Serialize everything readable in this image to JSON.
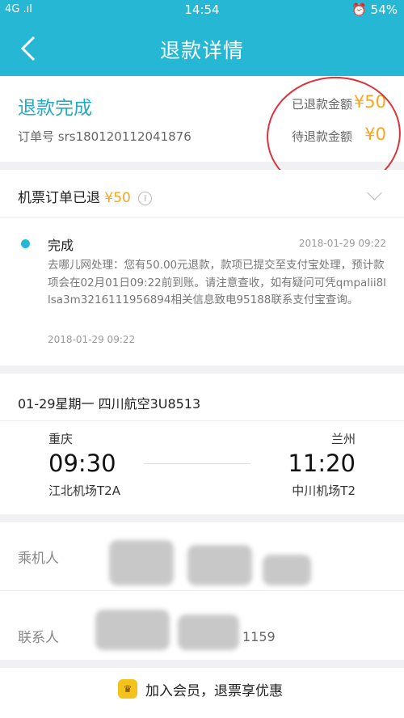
{
  "status_bar": {
    "left": "4G .ıl",
    "time": "14:54",
    "battery": "54%"
  },
  "nav": {
    "title": "退款详情"
  },
  "summary": {
    "status": "退款完成",
    "order_label": "订单号",
    "order_no": "srs180120112041876",
    "refunded_label": "已退款金额",
    "refunded_amount": "¥50",
    "pending_label": "待退款金额",
    "pending_amount": "¥0"
  },
  "refund": {
    "title": "机票订单已退",
    "amount": "¥50",
    "info_icon": "i",
    "progress_title": "完成",
    "progress_time": "2018-01-29 09:22",
    "progress_desc": "去哪儿网处理：您有50.00元退款，款项已提交至支付宝处理，预计款项会在02月01日09:22前到账。请注意查收，如有疑问可凭qmpalii8llsa3m3216111956894相关信息致电95188联系支付宝查询。",
    "progress_time2": "2018-01-29 09:22"
  },
  "flight": {
    "date_line": "01-29星期一  四川航空3U8513",
    "from_city": "重庆",
    "from_time": "09:30",
    "from_airport": "江北机场T2A",
    "to_city": "兰州",
    "to_time": "11:20",
    "to_airport": "中川机场T2"
  },
  "passenger": {
    "passenger_label": "乘机人",
    "contact_label": "联系人",
    "phone_suffix": "1159"
  },
  "bottom": {
    "vip_text": "加入会员，退票享优惠"
  },
  "colors": {
    "brand": "#25b7d3",
    "amount": "#f5a623",
    "annotation": "#d9343e"
  }
}
